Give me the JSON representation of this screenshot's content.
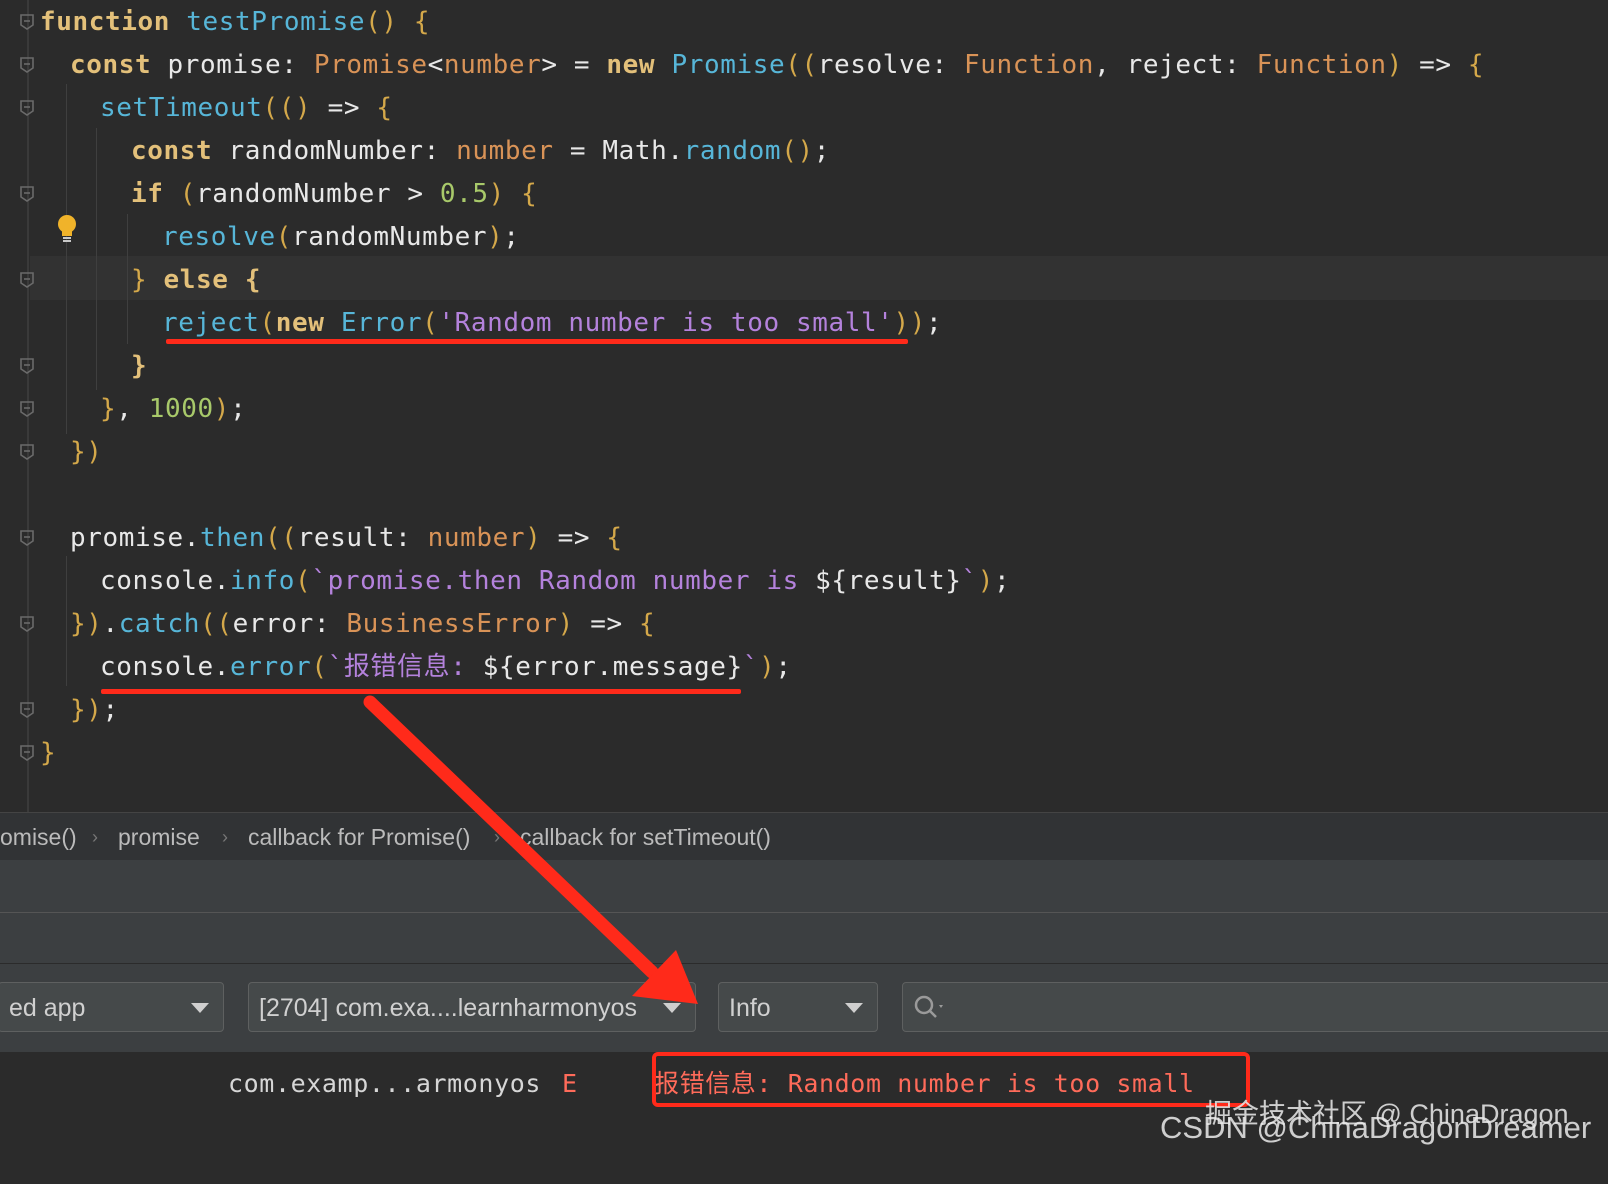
{
  "editor": {
    "lines": [
      {
        "id": "l1",
        "parts": [
          [
            "kw",
            "function"
          ],
          [
            "ops",
            " "
          ],
          [
            "fn",
            "testPromise"
          ],
          [
            "par",
            "()"
          ],
          [
            "ops",
            " "
          ],
          [
            "brc",
            "{"
          ]
        ]
      },
      {
        "id": "l2",
        "parts": [
          [
            "kw",
            "const"
          ],
          [
            "ops",
            " promise: "
          ],
          [
            "ty",
            "Promise"
          ],
          [
            "ops",
            "<"
          ],
          [
            "ty",
            "number"
          ],
          [
            "ops",
            "> = "
          ],
          [
            "kw",
            "new"
          ],
          [
            "ops",
            " "
          ],
          [
            "cls",
            "Promise"
          ],
          [
            "par",
            "(("
          ],
          [
            "ops",
            "resolve: "
          ],
          [
            "ty",
            "Function"
          ],
          [
            "ops",
            ", reject: "
          ],
          [
            "ty",
            "Function"
          ],
          [
            "par",
            ")"
          ],
          [
            "ops",
            " => "
          ],
          [
            "brc",
            "{"
          ]
        ]
      },
      {
        "id": "l3",
        "parts": [
          [
            "fn",
            "setTimeout"
          ],
          [
            "par",
            "(()"
          ],
          [
            "ops",
            " => "
          ],
          [
            "brc",
            "{"
          ]
        ]
      },
      {
        "id": "l4",
        "parts": [
          [
            "kw",
            "const"
          ],
          [
            "ops",
            " randomNumber: "
          ],
          [
            "ty",
            "number"
          ],
          [
            "ops",
            " = Math."
          ],
          [
            "fn",
            "random"
          ],
          [
            "par",
            "()"
          ],
          [
            "ops",
            ";"
          ]
        ]
      },
      {
        "id": "l5",
        "parts": [
          [
            "kw",
            "if"
          ],
          [
            "ops",
            " "
          ],
          [
            "par",
            "("
          ],
          [
            "ops",
            "randomNumber > "
          ],
          [
            "num",
            "0.5"
          ],
          [
            "par",
            ")"
          ],
          [
            "ops",
            " "
          ],
          [
            "brc",
            "{"
          ]
        ]
      },
      {
        "id": "l6",
        "parts": [
          [
            "fn",
            "resolve"
          ],
          [
            "par",
            "("
          ],
          [
            "ops",
            "randomNumber"
          ],
          [
            "par",
            ")"
          ],
          [
            "ops",
            ";"
          ]
        ]
      },
      {
        "id": "l7",
        "parts": [
          [
            "brc",
            "}"
          ],
          [
            "ops",
            " "
          ],
          [
            "kw",
            "else"
          ],
          [
            "ops",
            " "
          ],
          [
            "kw",
            "{"
          ]
        ]
      },
      {
        "id": "l8",
        "parts": [
          [
            "fn",
            "reject"
          ],
          [
            "par",
            "("
          ],
          [
            "kw",
            "new"
          ],
          [
            "ops",
            " "
          ],
          [
            "cls",
            "Error"
          ],
          [
            "par",
            "("
          ],
          [
            "str",
            "'Random number is too small'"
          ],
          [
            "par",
            "))"
          ],
          [
            "ops",
            ";"
          ]
        ]
      },
      {
        "id": "l9",
        "parts": [
          [
            "kw",
            "}"
          ]
        ]
      },
      {
        "id": "l10",
        "parts": [
          [
            "brc",
            "}"
          ],
          [
            "ops",
            ", "
          ],
          [
            "num",
            "1000"
          ],
          [
            "par",
            ")"
          ],
          [
            "ops",
            ";"
          ]
        ]
      },
      {
        "id": "l11",
        "parts": [
          [
            "brc",
            "})"
          ]
        ]
      },
      {
        "id": "l12",
        "parts": []
      },
      {
        "id": "l13",
        "parts": [
          [
            "ops",
            "promise."
          ],
          [
            "fn",
            "then"
          ],
          [
            "par",
            "(("
          ],
          [
            "ops",
            "result: "
          ],
          [
            "ty",
            "number"
          ],
          [
            "par",
            ")"
          ],
          [
            "ops",
            " => "
          ],
          [
            "brc",
            "{"
          ]
        ]
      },
      {
        "id": "l14",
        "parts": [
          [
            "ops",
            "console."
          ],
          [
            "fn",
            "info"
          ],
          [
            "par",
            "("
          ],
          [
            "str",
            "`promise.then Random number is "
          ],
          [
            "ops",
            "${result}"
          ],
          [
            "str",
            "`"
          ],
          [
            "par",
            ")"
          ],
          [
            "ops",
            ";"
          ]
        ]
      },
      {
        "id": "l15",
        "parts": [
          [
            "brc",
            "}"
          ],
          [
            "par",
            ")"
          ],
          [
            "ops",
            "."
          ],
          [
            "fn",
            "catch"
          ],
          [
            "par",
            "(("
          ],
          [
            "ops",
            "error: "
          ],
          [
            "ty",
            "BusinessError"
          ],
          [
            "par",
            ")"
          ],
          [
            "ops",
            " => "
          ],
          [
            "brc",
            "{"
          ]
        ]
      },
      {
        "id": "l16",
        "parts": [
          [
            "ops",
            "console."
          ],
          [
            "fn",
            "error"
          ],
          [
            "par",
            "("
          ],
          [
            "str",
            "`报错信息: "
          ],
          [
            "ops",
            "${error.message}"
          ],
          [
            "str",
            "`"
          ],
          [
            "par",
            ")"
          ],
          [
            "ops",
            ";"
          ]
        ]
      },
      {
        "id": "l17",
        "parts": [
          [
            "brc",
            "})"
          ],
          [
            "ops",
            ";"
          ]
        ]
      },
      {
        "id": "l18",
        "parts": [
          [
            "brc",
            "}"
          ]
        ]
      }
    ]
  },
  "breadcrumb": [
    "omise()",
    "promise",
    "callback for Promise()",
    "callback for setTimeout()"
  ],
  "filters": {
    "device_combo": "ed app",
    "process_combo": "[2704] com.exa....learnharmonyos",
    "level_combo": "Info",
    "search_placeholder": ""
  },
  "log": {
    "tag": "com.examp...armonyos",
    "level": "E",
    "message": "报错信息: Random number is too small"
  },
  "watermark": {
    "line1": "掘金技术社区 @ ChinaDragon",
    "line2": "CSDN @ChinaDragonDreamer"
  },
  "colors": {
    "annotation_red": "#ff2a1a",
    "log_error_red": "#ff6b5a"
  },
  "icons": [
    "fold-icon",
    "lightbulb-icon",
    "chevron-down-icon",
    "search-icon",
    "arrow-annotation"
  ]
}
